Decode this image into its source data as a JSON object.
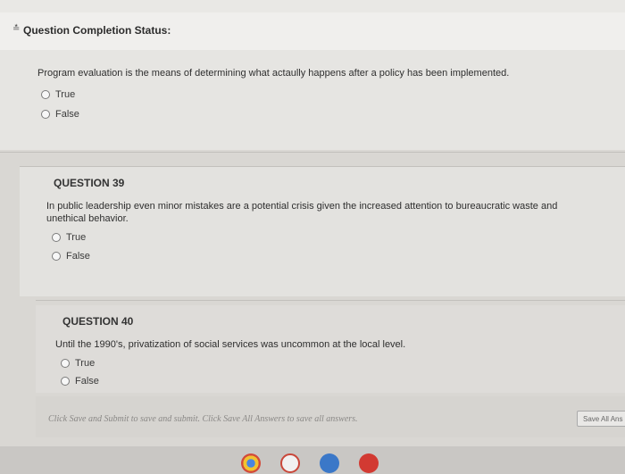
{
  "status": {
    "title": "Question Completion Status:"
  },
  "questions": [
    {
      "title": "",
      "text": "Program evaluation is the means of determining what actaully happens after a policy has been implemented.",
      "options": [
        "True",
        "False"
      ]
    },
    {
      "title": "QUESTION 39",
      "text_line1": "In public leadership even minor mistakes are a potential crisis given the increased attention to bureaucratic waste and",
      "text_line2": "unethical behavior.",
      "options": [
        "True",
        "False"
      ]
    },
    {
      "title": "QUESTION 40",
      "text": "Until the 1990's, privatization of social services was uncommon at the local level.",
      "options": [
        "True",
        "False"
      ]
    }
  ],
  "footer": {
    "instruction": "Click Save and Submit to save and submit. Click Save All Answers to save all answers.",
    "save_all_label": "Save All Ans"
  },
  "taskbar_icons": [
    {
      "name": "chrome-icon",
      "color": "#d24a3a"
    },
    {
      "name": "gmail-icon",
      "color": "#c9473a"
    },
    {
      "name": "docs-icon",
      "color": "#3b78c8"
    },
    {
      "name": "youtube-icon",
      "color": "#d23a32"
    }
  ]
}
